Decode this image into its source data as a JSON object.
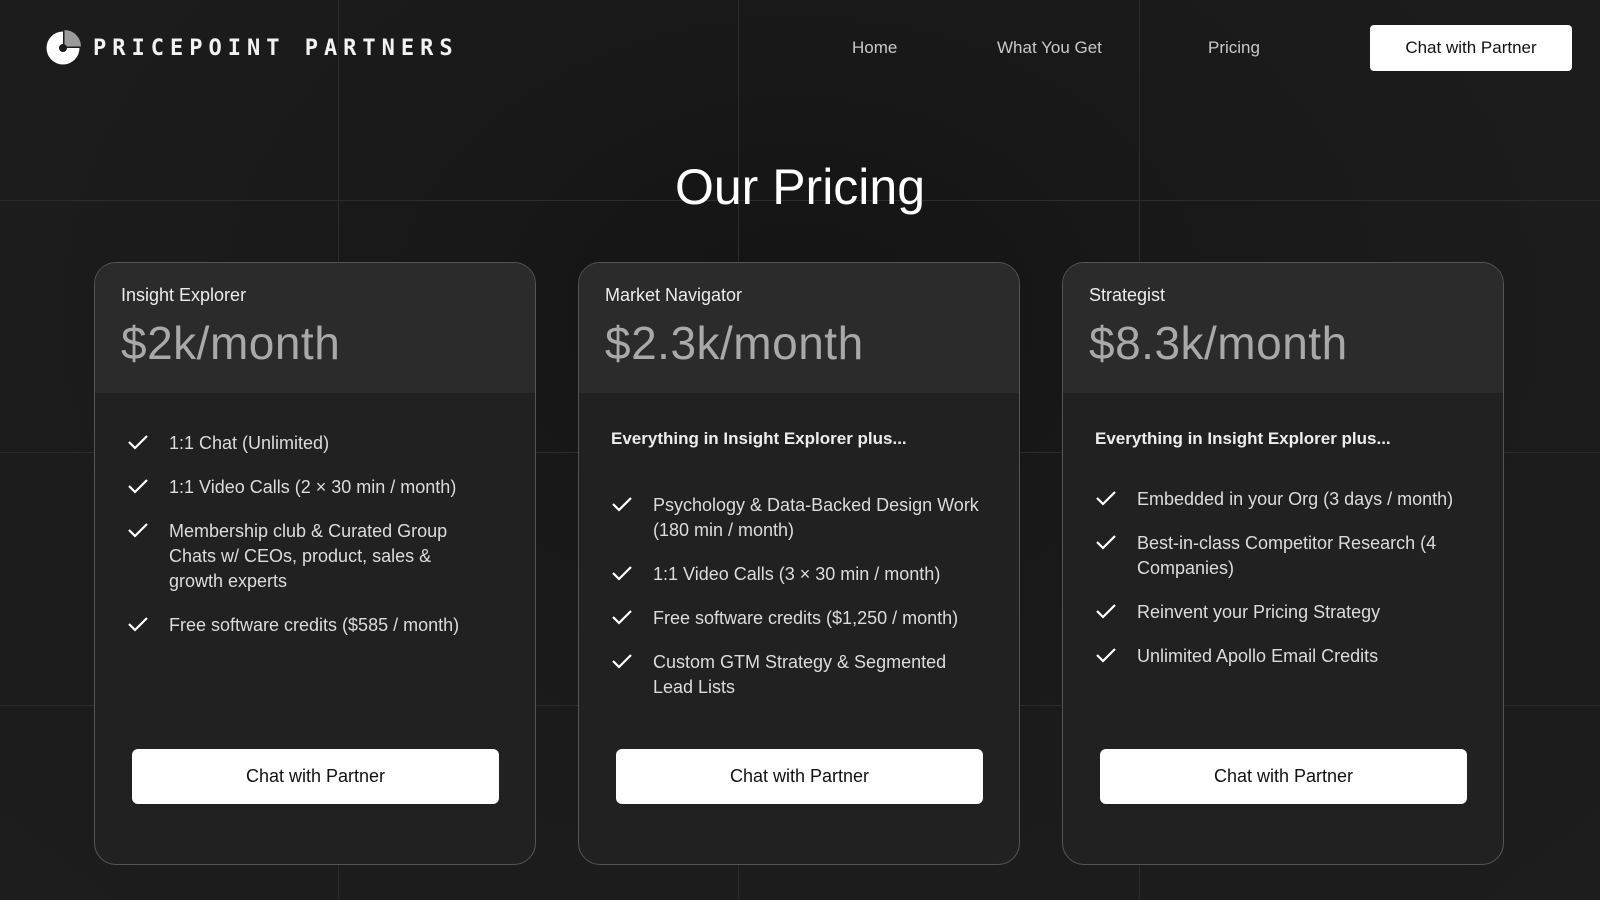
{
  "brand": {
    "name": "PRICEPOINT PARTNERS",
    "logo_icon": "pie-logo-icon"
  },
  "nav": {
    "items": [
      {
        "label": "Home"
      },
      {
        "label": "What You Get"
      },
      {
        "label": "Pricing"
      }
    ],
    "cta": "Chat with Partner"
  },
  "page": {
    "title": "Our Pricing"
  },
  "colors": {
    "background": "#1a1a1a",
    "card": "#212121",
    "card_header": "#2b2b2b",
    "price": "#a9a9a9",
    "button": "#ffffff"
  },
  "plans": [
    {
      "name": "Insight Explorer",
      "price": "$2k/month",
      "intro": "",
      "features": [
        "1:1 Chat (Unlimited)",
        "1:1 Video Calls (2 × 30 min / month)",
        "Membership club & Curated Group Chats w/ CEOs, product, sales & growth experts",
        "Free software credits ($585 / month)"
      ],
      "cta": "Chat with Partner"
    },
    {
      "name": "Market Navigator",
      "price": "$2.3k/month",
      "intro": "Everything in Insight Explorer plus...",
      "features": [
        "Psychology & Data-Backed Design Work (180 min / month)",
        "1:1 Video Calls (3 × 30 min / month)",
        "Free software credits ($1,250 / month)",
        "Custom GTM Strategy & Segmented Lead Lists"
      ],
      "cta": "Chat with Partner"
    },
    {
      "name": "Strategist",
      "price": "$8.3k/month",
      "intro": "Everything in Insight Explorer plus...",
      "features": [
        "Embedded in your Org (3 days / month)",
        "Best-in-class Competitor Research (4 Companies)",
        "Reinvent your Pricing Strategy",
        "Unlimited Apollo Email Credits"
      ],
      "cta": "Chat with Partner"
    }
  ]
}
